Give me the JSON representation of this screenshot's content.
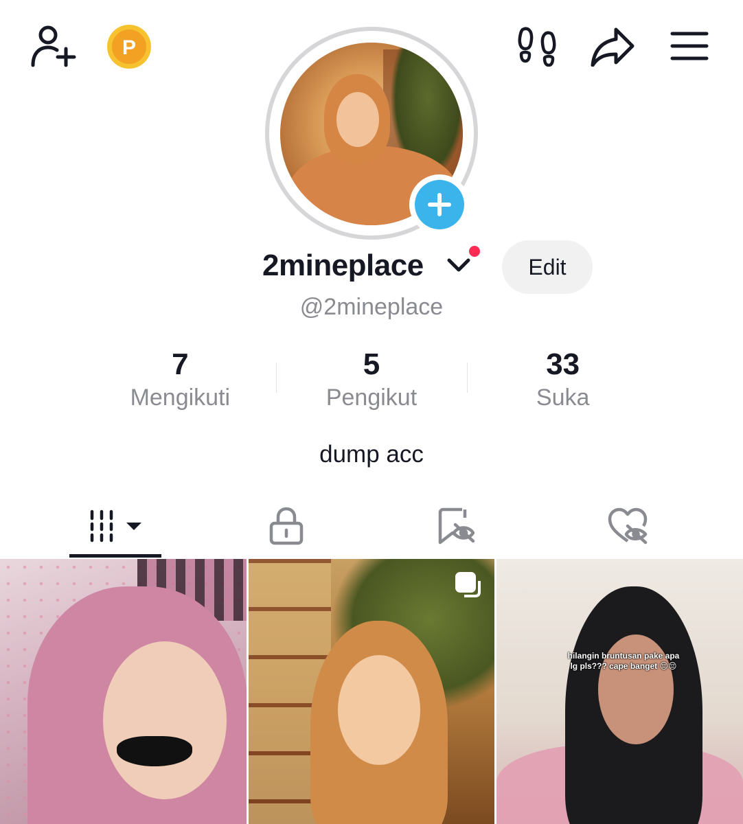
{
  "header": {
    "add_friend_icon": "person-plus-icon",
    "points_badge": "P",
    "visitors_icon": "footprints-icon",
    "share_icon": "share-arrow-icon",
    "menu_icon": "hamburger-menu-icon"
  },
  "profile": {
    "display_name": "2mineplace",
    "handle": "@2mineplace",
    "edit_label": "Edit",
    "bio": "dump acc",
    "accent_color": "#3bb4ec",
    "notification_dot_color": "#fe2c55"
  },
  "stats": [
    {
      "value": "7",
      "label": "Mengikuti"
    },
    {
      "value": "5",
      "label": "Pengikut"
    },
    {
      "value": "33",
      "label": "Suka"
    }
  ],
  "tabs": [
    {
      "name": "videos",
      "icon": "grid-icon",
      "active": true
    },
    {
      "name": "private",
      "icon": "lock-icon",
      "active": false
    },
    {
      "name": "saved",
      "icon": "bookmark-hidden-icon",
      "active": false
    },
    {
      "name": "liked",
      "icon": "heart-hidden-icon",
      "active": false
    }
  ],
  "videos": [
    {
      "thumb": "pink-hijab-mustache-filter"
    },
    {
      "thumb": "orange-hijab-plant",
      "multi": true
    },
    {
      "thumb": "black-hijab-caption",
      "caption": "hilangin bruntusan pake apa lg pls??? cape banget 😔😔"
    }
  ]
}
